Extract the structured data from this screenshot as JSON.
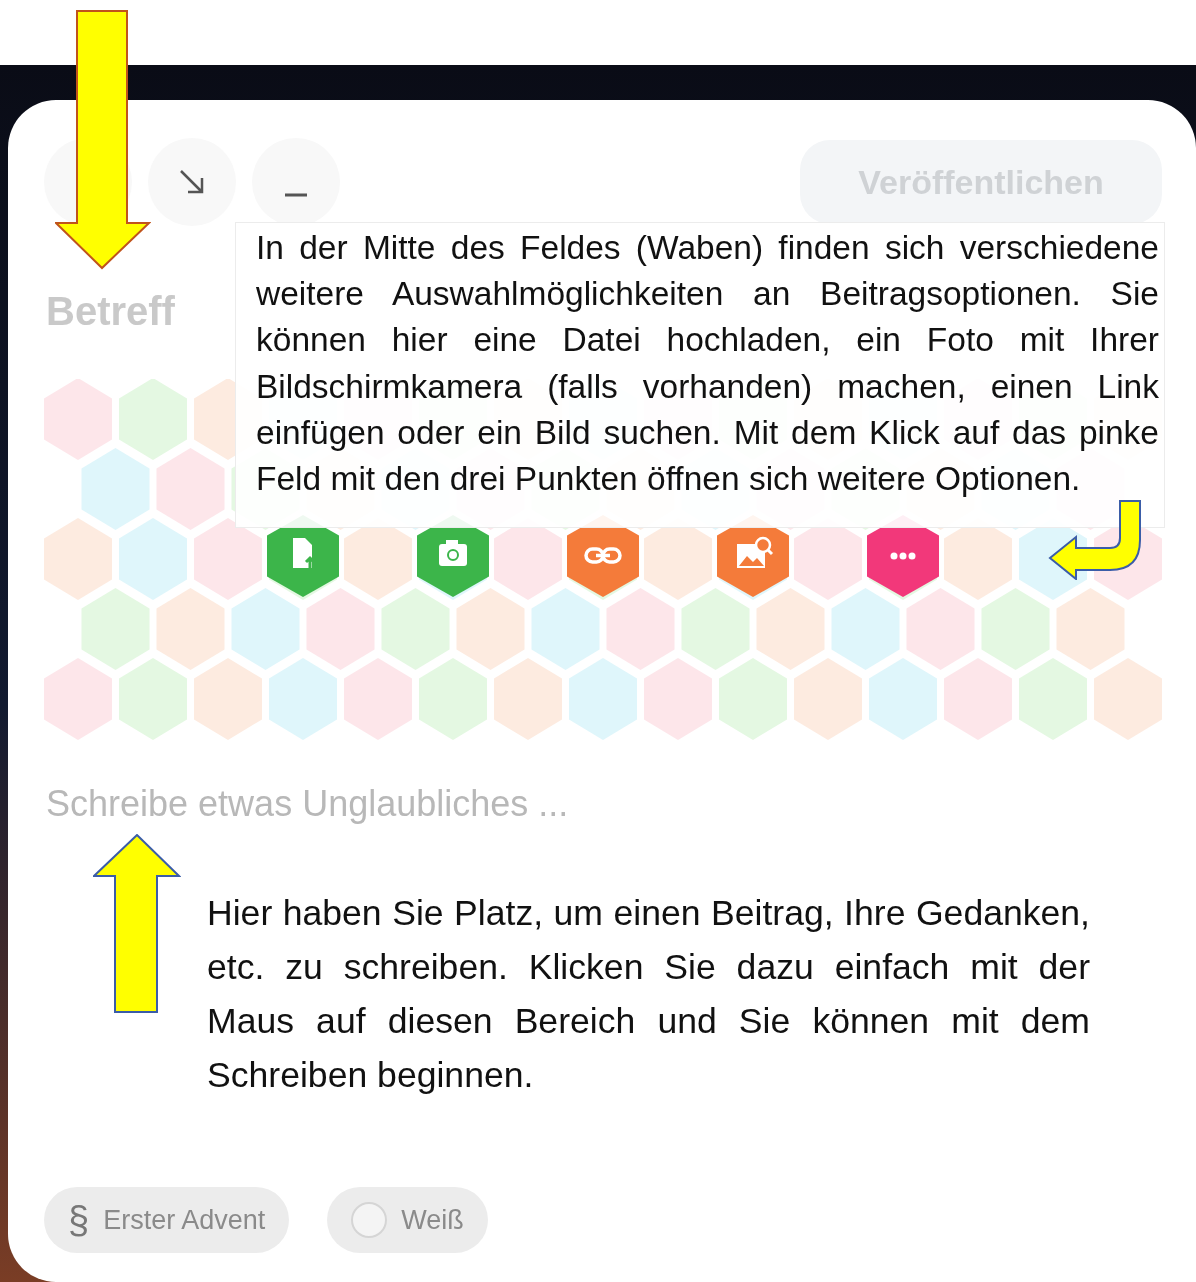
{
  "header": {
    "publish_button": "Veröffentlichen"
  },
  "subject": {
    "placeholder": "Betreff"
  },
  "options": [
    {
      "kind": "file-upload",
      "color": "#3cb54a"
    },
    {
      "kind": "camera",
      "color": "#3cb54a"
    },
    {
      "kind": "link",
      "color": "#f47b3a"
    },
    {
      "kind": "image-search",
      "color": "#f47b3a"
    },
    {
      "kind": "more",
      "color": "#f2387a"
    }
  ],
  "body": {
    "placeholder": "Schreibe etwas Unglaubliches ..."
  },
  "tags": [
    {
      "kind": "symbol",
      "symbol": "§",
      "label": "Erster Advent"
    },
    {
      "kind": "swatch",
      "color": "#f4f4f4",
      "label": "Weiß"
    }
  ],
  "annotations": [
    {
      "kind": "top",
      "text": "In der Mitte des Feldes (Waben) finden sich verschiedene weitere Auswahlmöglichkeiten an Beitragsoptionen. Sie können hier eine Datei hochladen, ein Foto mit Ihrer Bildschirmkamera (falls vorhanden) machen, einen Link einfügen oder ein Bild suchen. Mit dem Klick auf das pinke Feld mit den drei Punkten öffnen sich weitere Optionen."
    },
    {
      "kind": "bottom",
      "text": "Hier haben Sie Platz, um einen Beitrag, Ihre Gedanken, etc. zu schreiben. Klicken Sie dazu einfach mit der Maus auf diesen Bereich und Sie können mit dem Schreiben beginnen."
    }
  ]
}
